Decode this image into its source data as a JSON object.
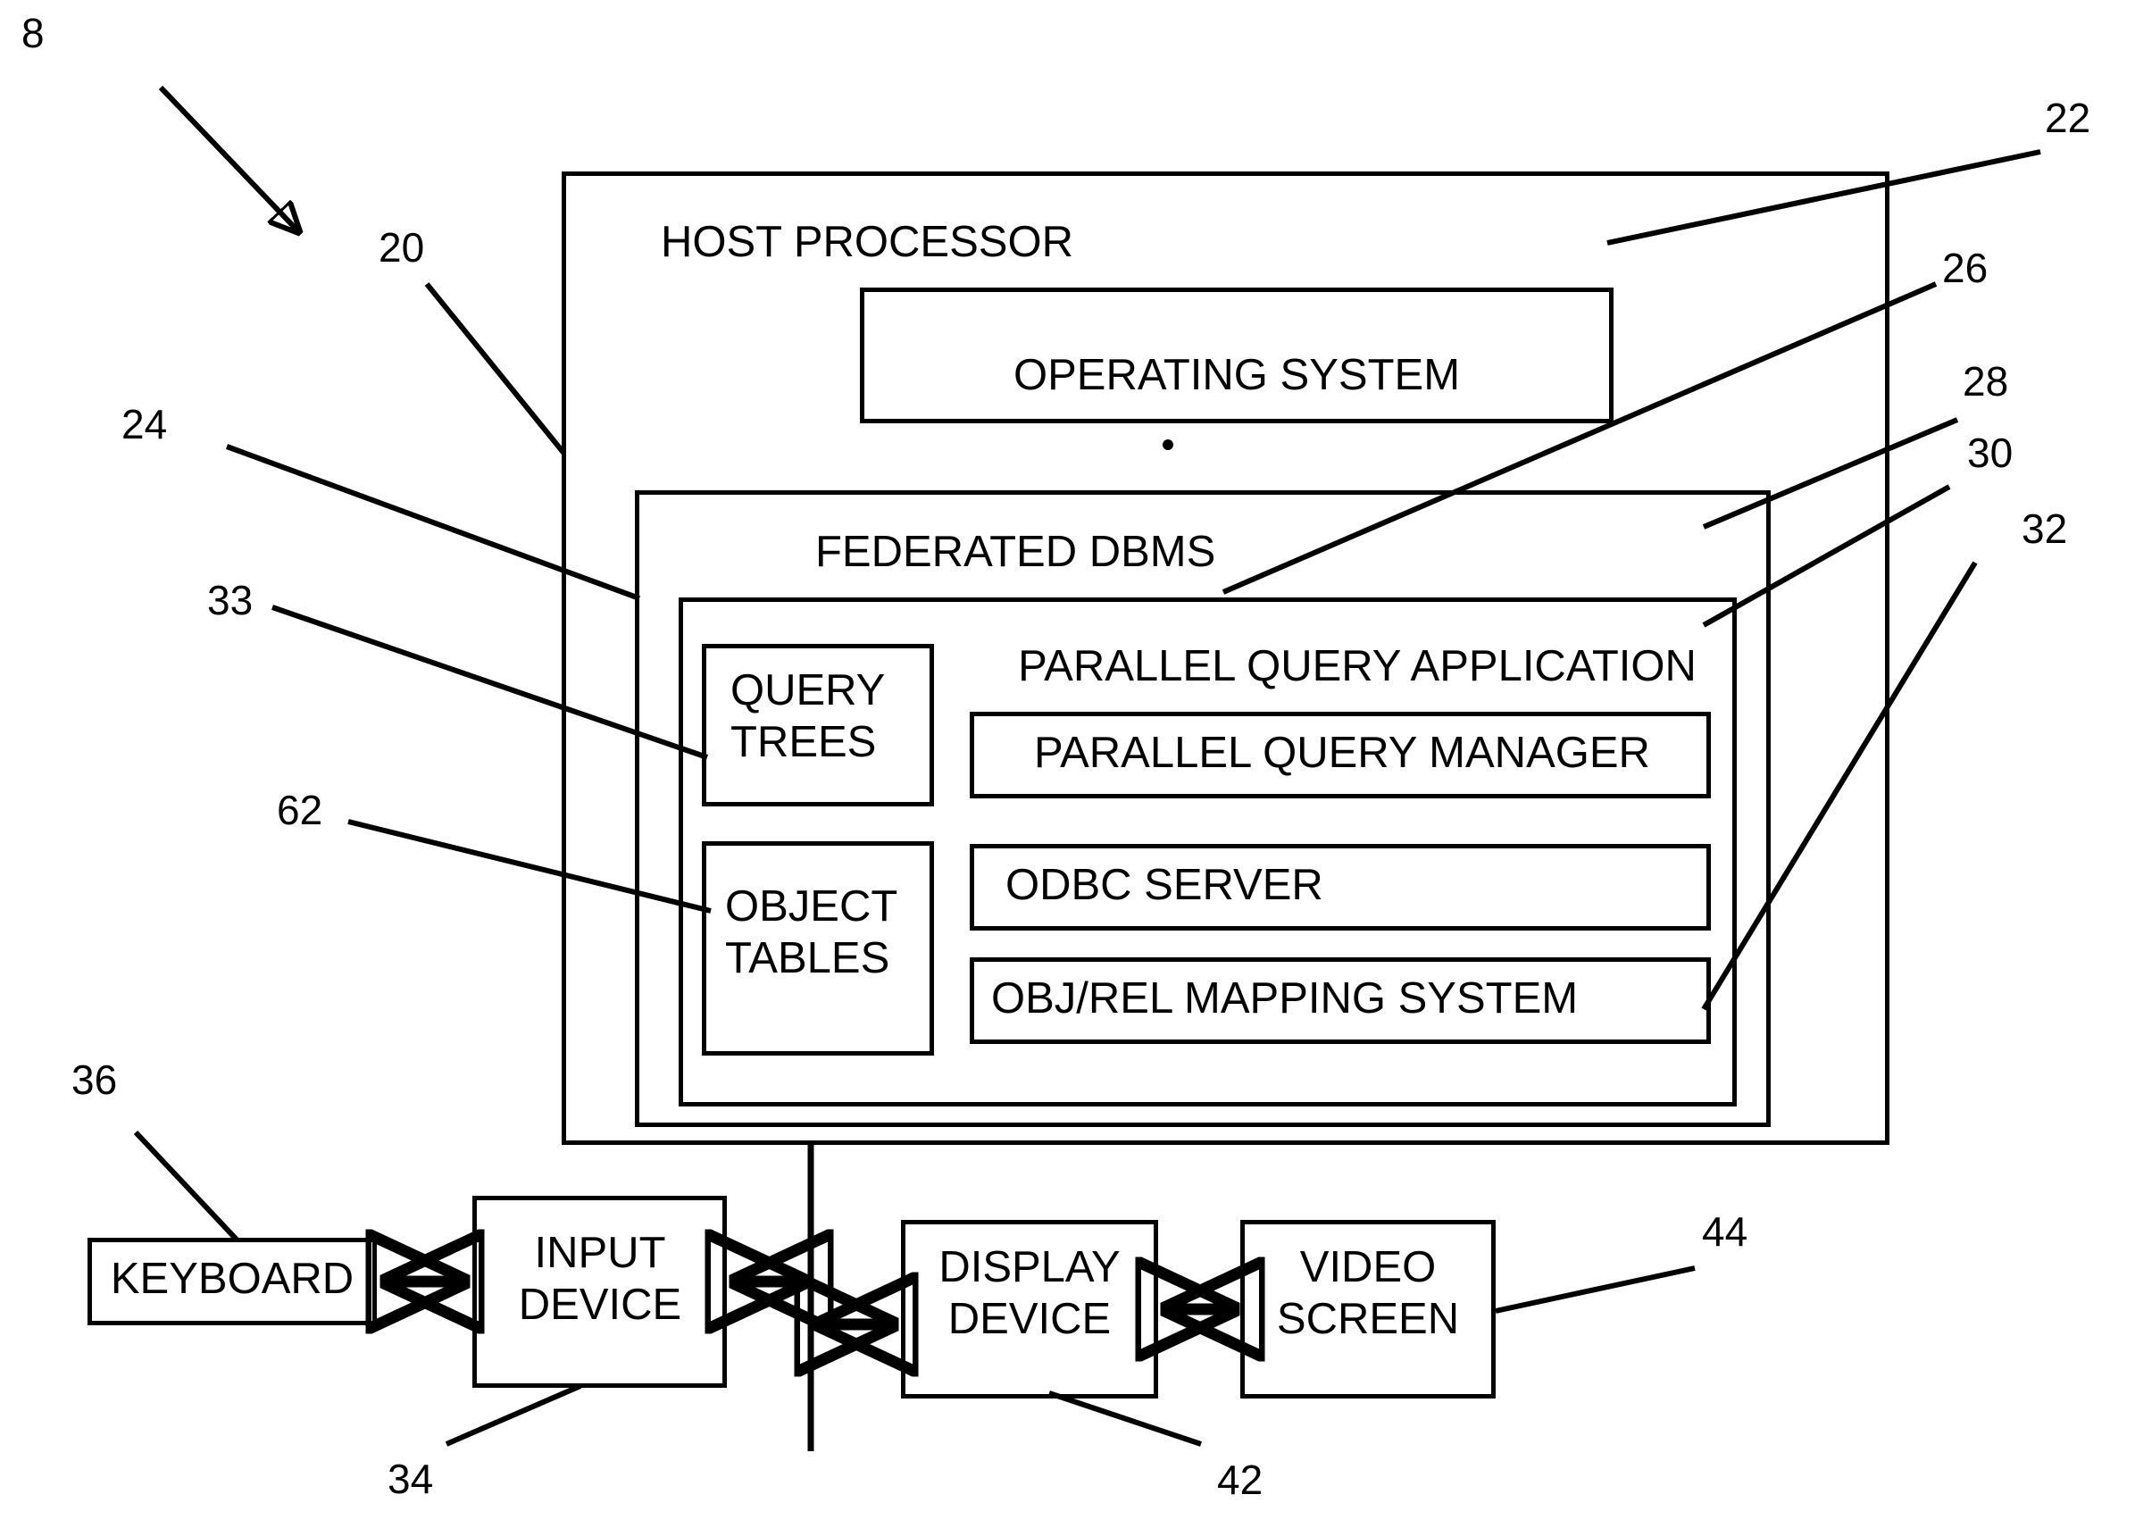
{
  "figure": {
    "title_numeral": "8",
    "boxes": {
      "host_processor": "HOST PROCESSOR",
      "operating_system": "OPERATING SYSTEM",
      "federated_dbms": "FEDERATED DBMS",
      "parallel_query_application": "PARALLEL QUERY APPLICATION",
      "query_trees_line1": "QUERY",
      "query_trees_line2": "TREES",
      "object_tables_line1": "OBJECT",
      "object_tables_line2": "TABLES",
      "parallel_query_manager": "PARALLEL QUERY MANAGER",
      "odbc_server": "ODBC SERVER",
      "obj_rel_mapping_system": "OBJ/REL MAPPING SYSTEM",
      "keyboard": "KEYBOARD",
      "input_device_line1": "INPUT",
      "input_device_line2": "DEVICE",
      "display_device_line1": "DISPLAY",
      "display_device_line2": "DEVICE",
      "video_screen_line1": "VIDEO",
      "video_screen_line2": "SCREEN"
    },
    "reference_numerals": {
      "system": "8",
      "host_processor": "20",
      "operating_system": "22",
      "federated_dbms": "24",
      "parallel_query_application": "26",
      "parallel_query_manager": "28",
      "odbc_server": "30",
      "obj_rel_mapping_system": "32",
      "query_trees": "33",
      "input_device": "34",
      "keyboard": "36",
      "display_device": "42",
      "video_screen": "44",
      "object_tables": "62"
    },
    "colors": {
      "line": "#000000",
      "background": "#ffffff",
      "text": "#000000"
    }
  }
}
